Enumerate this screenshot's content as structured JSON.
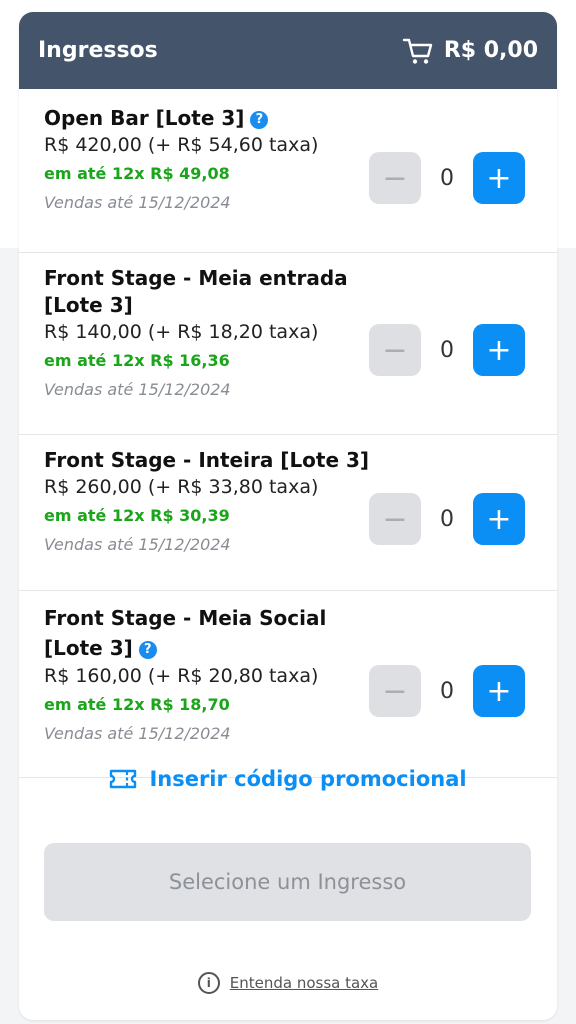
{
  "header": {
    "title": "Ingressos",
    "cart_icon": "shopping-cart-icon",
    "total": "R$ 0,00",
    "background": "#44546a"
  },
  "tickets": [
    {
      "name": "Open Bar [Lote 3]",
      "has_help": true,
      "price": "R$ 420,00 (+ R$ 54,60 taxa)",
      "installments": "em até 12x R$ 49,08",
      "sales_until": "Vendas até 15/12/2024",
      "quantity": "0"
    },
    {
      "name": "Front Stage - Meia entrada [Lote 3]",
      "has_help": false,
      "price": "R$ 140,00 (+ R$ 18,20 taxa)",
      "installments": "em até 12x R$ 16,36",
      "sales_until": "Vendas até 15/12/2024",
      "quantity": "0"
    },
    {
      "name": "Front Stage - Inteira [Lote 3]",
      "has_help": false,
      "price": "R$ 260,00 (+ R$ 33,80 taxa)",
      "installments": "em até 12x R$ 30,39",
      "sales_until": "Vendas até 15/12/2024",
      "quantity": "0"
    },
    {
      "name": "Front Stage - Meia Social [Lote 3]",
      "has_help": true,
      "price": "R$ 160,00 (+ R$ 20,80 taxa)",
      "installments": "em até 12x R$ 18,70",
      "sales_until": "Vendas até 15/12/2024",
      "quantity": "0"
    }
  ],
  "controls": {
    "minus": "−",
    "plus": "+",
    "help": "?"
  },
  "promo": {
    "label": "Inserir código promocional",
    "icon": "ticket-icon"
  },
  "select_button": {
    "label": "Selecione um Ingresso"
  },
  "fee_info": {
    "icon": "info-icon",
    "link": "Entenda nossa taxa"
  },
  "colors": {
    "accent": "#0b8ff5",
    "installment_green": "#1aa51a",
    "disabled": "#dfe1e5"
  }
}
